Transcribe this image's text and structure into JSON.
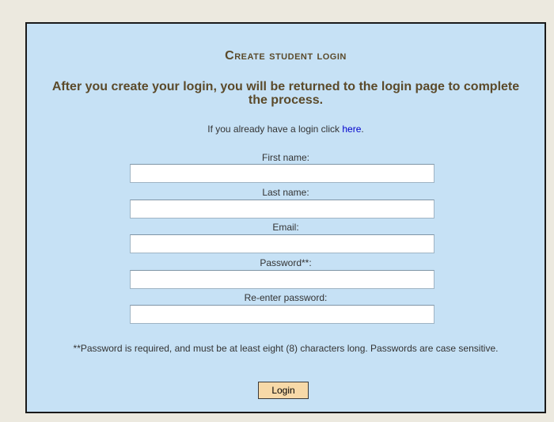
{
  "form": {
    "title": "Create student login",
    "subtitle": "After you create your login, you will be returned to the login page to complete the process.",
    "already_text": "If you already have a login click",
    "already_link": "here",
    "already_suffix": ".",
    "fields": [
      {
        "label": "First name:",
        "value": "",
        "placeholder": ""
      },
      {
        "label": "Last name:",
        "value": "",
        "placeholder": ""
      },
      {
        "label": "Email:",
        "value": "",
        "placeholder": ""
      },
      {
        "label": "Password**:",
        "value": "",
        "placeholder": ""
      },
      {
        "label": "Re-enter password:",
        "value": "",
        "placeholder": ""
      }
    ],
    "password_note": "**Password is required, and must be at least eight (8) characters long. Passwords are case sensitive.",
    "login_button": "Login"
  },
  "colors": {
    "page_background": "#ece9df",
    "panel_background": "#c6e1f5",
    "heading_color": "#5b4a2a",
    "link_color": "#0000cc",
    "button_background": "#f7d9a8"
  }
}
